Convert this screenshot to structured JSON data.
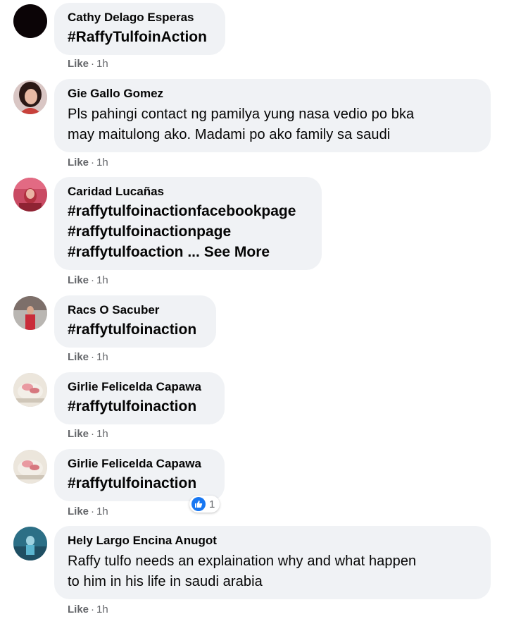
{
  "colors": {
    "bubble": "#f0f2f5",
    "meta_text": "#65676b",
    "like_blue": "#1877f2"
  },
  "comments": [
    {
      "author": "Cathy Delago Esperas",
      "lines": [
        "#RaffyTulfoinAction"
      ],
      "like_label": "Like",
      "time": "1h",
      "avatar_icon": "black-circle-avatar"
    },
    {
      "author": "Gie Gallo Gomez",
      "lines": [
        "Pls pahingi contact ng pamilya yung nasa vedio po bka",
        "may maitulong ako. Madami po ako family sa saudi"
      ],
      "like_label": "Like",
      "time": "1h",
      "avatar_icon": "woman-portrait-avatar"
    },
    {
      "author": "Caridad Lucañas",
      "lines": [
        "#raffytulfoinactionfacebookpage",
        "#raffytulfoinactionpage",
        "#raffytulfoaction ..."
      ],
      "see_more": "See More",
      "like_label": "Like",
      "time": "1h",
      "avatar_icon": "pink-portrait-avatar"
    },
    {
      "author": "Racs O Sacuber",
      "lines": [
        "#raffytulfoinaction"
      ],
      "like_label": "Like",
      "time": "1h",
      "avatar_icon": "person-photo-avatar"
    },
    {
      "author": "Girlie Felicelda Capawa",
      "lines": [
        "#raffytulfoinaction"
      ],
      "like_label": "Like",
      "time": "1h",
      "avatar_icon": "cake-photo-avatar"
    },
    {
      "author": "Girlie Felicelda Capawa",
      "lines": [
        "#raffytulfoinaction"
      ],
      "like_label": "Like",
      "time": "1h",
      "avatar_icon": "cake-photo-avatar",
      "reaction_count": "1",
      "reaction_icon": "thumbs-up-icon"
    },
    {
      "author": "Hely Largo Encina Anugot",
      "lines": [
        "Raffy tulfo needs an explaination why and what happen",
        "to him in his life in saudi arabia"
      ],
      "like_label": "Like",
      "time": "1h",
      "avatar_icon": "blue-scene-avatar"
    }
  ]
}
